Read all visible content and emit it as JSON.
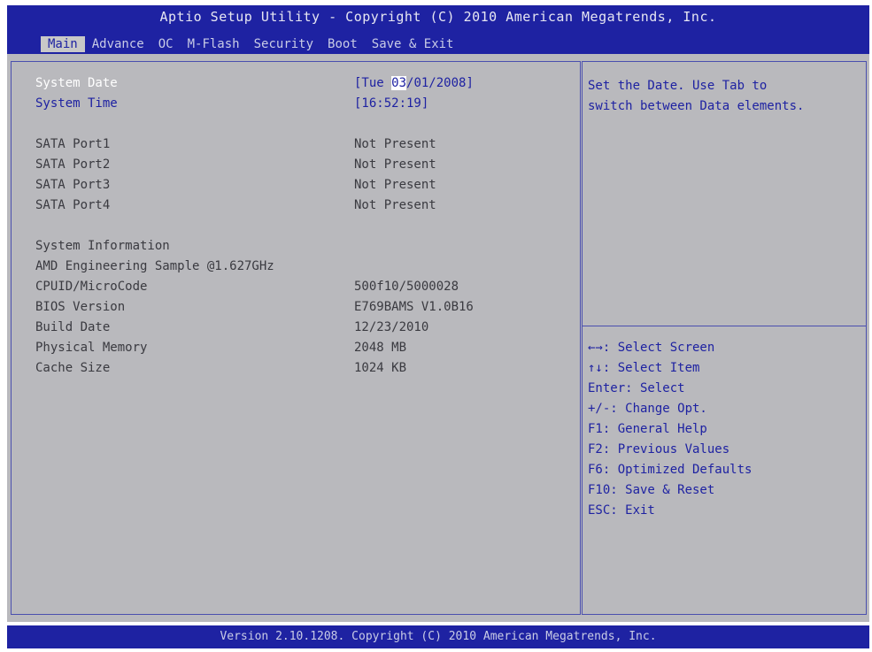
{
  "header": {
    "title": "Aptio Setup Utility - Copyright (C) 2010 American Megatrends, Inc.",
    "tabs": [
      "Main",
      "Advance",
      "OC",
      "M-Flash",
      "Security",
      "Boot",
      "Save & Exit"
    ]
  },
  "main": {
    "system_date": {
      "label": "System Date",
      "value_prefix": "[Tue ",
      "value_cursor": "03",
      "value_suffix": "/01/2008]"
    },
    "system_time": {
      "label": "System Time",
      "value": "[16:52:19]"
    },
    "sata_ports": [
      {
        "label": "SATA Port1",
        "value": "Not Present"
      },
      {
        "label": "SATA Port2",
        "value": "Not Present"
      },
      {
        "label": "SATA Port3",
        "value": "Not Present"
      },
      {
        "label": "SATA Port4",
        "value": "Not Present"
      }
    ],
    "system_info": {
      "heading": "System Information",
      "cpu": "AMD Engineering Sample @1.627GHz",
      "rows": [
        {
          "label": "CPUID/MicroCode",
          "value": "500f10/5000028"
        },
        {
          "label": "BIOS Version",
          "value": "E769BAMS V1.0B16"
        },
        {
          "label": "Build Date",
          "value": "12/23/2010"
        },
        {
          "label": "Physical Memory",
          "value": "2048 MB"
        },
        {
          "label": "Cache Size",
          "value": "1024 KB"
        }
      ]
    }
  },
  "help": {
    "line1": "Set the Date. Use Tab to",
    "line2": "switch between Data elements."
  },
  "keys": [
    "←→: Select Screen",
    "↑↓: Select Item",
    "Enter: Select",
    "+/-: Change Opt.",
    "F1: General Help",
    "F2: Previous Values",
    "F6: Optimized Defaults",
    "F10: Save & Reset",
    "ESC: Exit"
  ],
  "footer": {
    "text": "Version 2.10.1208. Copyright (C) 2010 American Megatrends, Inc."
  },
  "colors": {
    "accent_blue": "#1e22a2",
    "panel_gray": "#b9b9bd",
    "selected_text": "#ffffff"
  }
}
